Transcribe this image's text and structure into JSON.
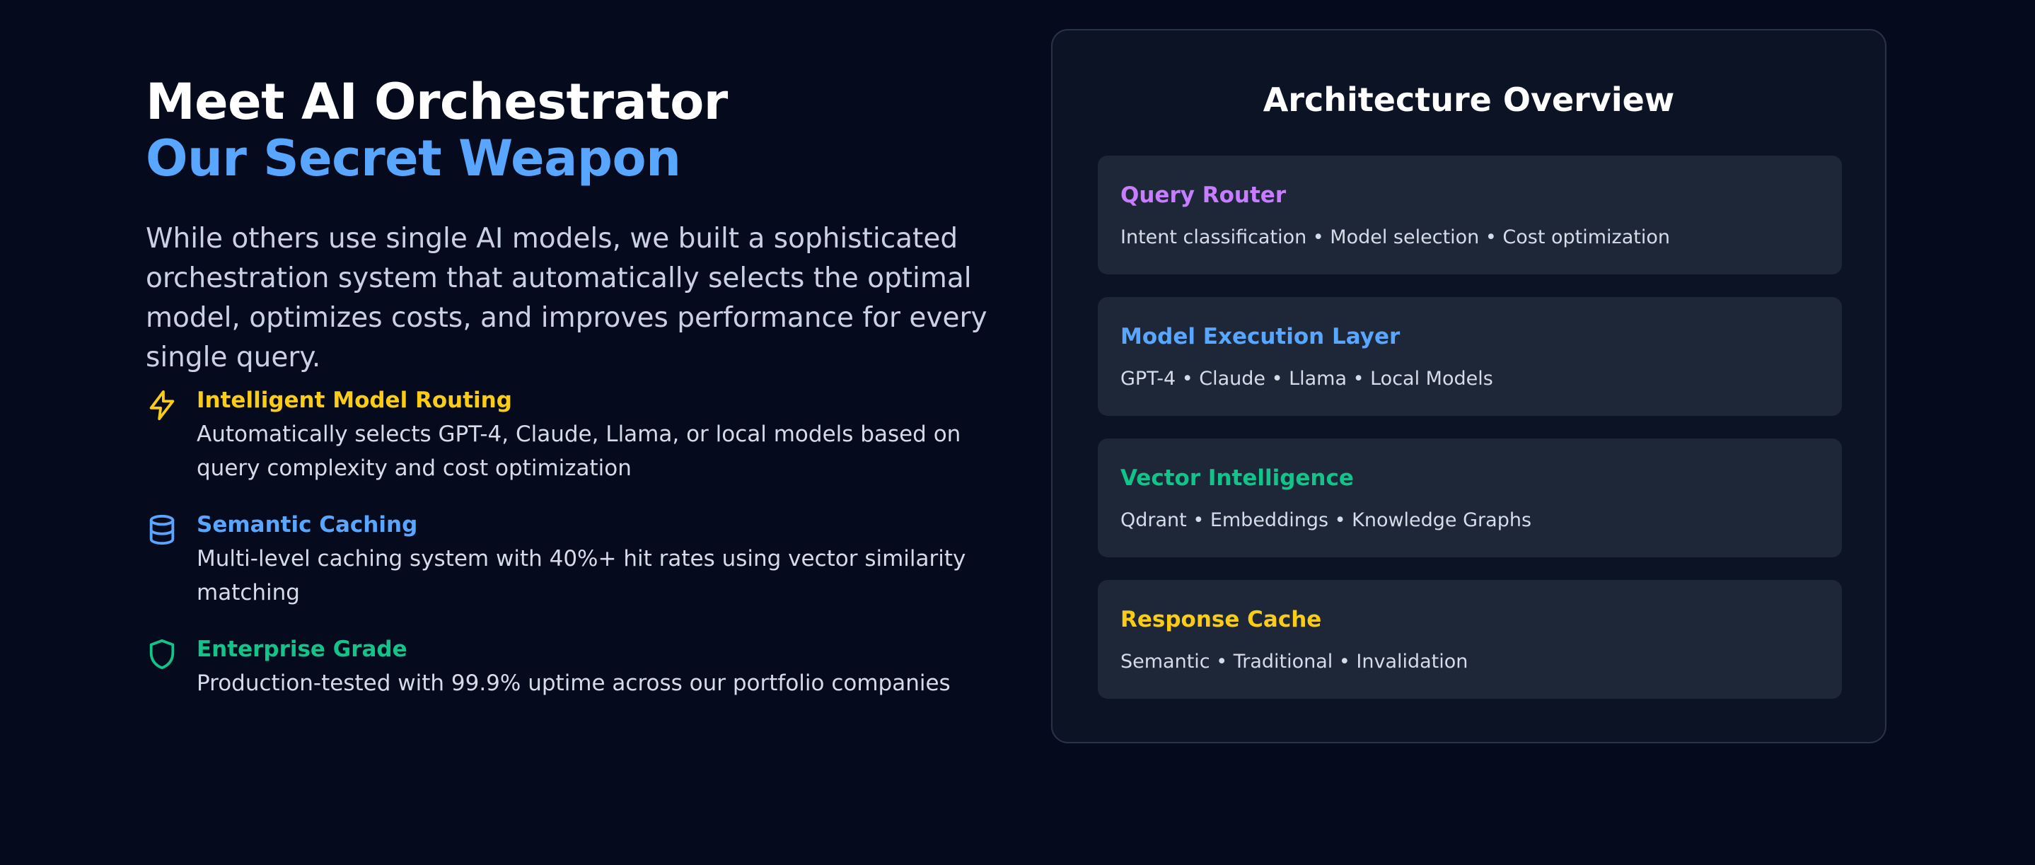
{
  "hero": {
    "title_line1": "Meet AI Orchestrator",
    "title_line2": "Our Secret Weapon",
    "description": "While others use single AI models, we built a sophisticated orchestration system that automatically selects the optimal model, optimizes costs, and improves performance for every single query."
  },
  "features": [
    {
      "icon": "lightning-icon",
      "title": "Intelligent Model Routing",
      "description": "Automatically selects GPT-4, Claude, Llama, or local models based on query complexity and cost optimization",
      "color": "#facc15"
    },
    {
      "icon": "database-icon",
      "title": "Semantic Caching",
      "description": "Multi-level caching system with 40%+ hit rates using vector similarity matching",
      "color": "#58a6ff"
    },
    {
      "icon": "shield-icon",
      "title": "Enterprise Grade",
      "description": "Production-tested with 99.9% uptime across our portfolio companies",
      "color": "#10c48a"
    }
  ],
  "architecture": {
    "title": "Architecture Overview",
    "layers": [
      {
        "title": "Query Router",
        "description": "Intent classification • Model selection • Cost optimization",
        "color": "#c77dff"
      },
      {
        "title": "Model Execution Layer",
        "description": "GPT-4 • Claude • Llama • Local Models",
        "color": "#58a6ff"
      },
      {
        "title": "Vector Intelligence",
        "description": "Qdrant • Embeddings • Knowledge Graphs",
        "color": "#10c48a"
      },
      {
        "title": "Response Cache",
        "description": "Semantic • Traditional • Invalidation",
        "color": "#facc15"
      }
    ]
  },
  "colors": {
    "background": "#050a1c",
    "panel": "#0c1324",
    "card": "#1e2738",
    "accent_blue": "#58a6ff"
  }
}
